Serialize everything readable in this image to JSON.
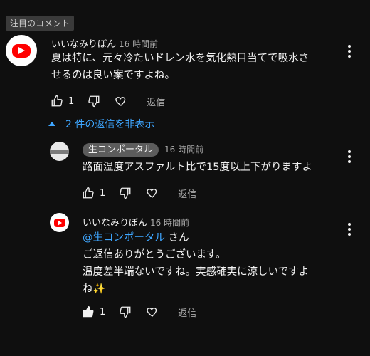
{
  "pinned_label": "注目のコメント",
  "comment": {
    "author": "いいなみりぼん",
    "time": "16 時間前",
    "text_line1": "夏は特に、元々冷たいドレン水を気化熱目当てで吸水さ",
    "text_line2": "せるのは良い案ですよね。",
    "like_count": "1",
    "reply_label": "返信"
  },
  "replies_toggle": "2 件の返信を非表示",
  "reply1": {
    "author": "生コンポータル",
    "time": "16 時間前",
    "text": "路面温度アスファルト比で15度以上下がりますよ",
    "like_count": "1",
    "reply_label": "返信"
  },
  "reply2": {
    "author": "いいなみりぼん",
    "time": "16 時間前",
    "mention": "@生コンポータル",
    "mention_suffix": " さん",
    "line2": "ご返信ありがとうございます。",
    "line3": "温度差半端ないですね。実感確実に涼しいですよ",
    "line4": "ね✨",
    "like_count": "1",
    "reply_label": "返信"
  },
  "icons": {
    "like": "thumbs-up-icon",
    "dislike": "thumbs-down-icon",
    "heart": "heart-icon",
    "menu": "more-vert-icon",
    "caret": "caret-up-icon"
  }
}
